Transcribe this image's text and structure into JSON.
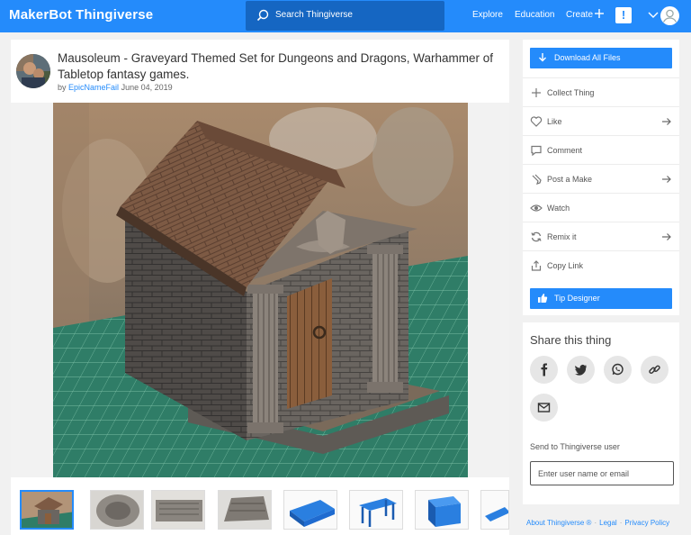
{
  "header": {
    "logo_maker": "MakerBot",
    "logo_thing": "Thingiverse",
    "search_placeholder": "Search Thingiverse",
    "nav_explore": "Explore",
    "nav_education": "Education",
    "nav_create": "Create",
    "alert_glyph": "!"
  },
  "thing": {
    "title": "Mausoleum - Graveyard Themed Set for Dungeons and Dragons, Warhammer of Tabletop fantasy games.",
    "by": "by",
    "author": "EpicNameFail",
    "date": "June 04, 2019"
  },
  "sidebar": {
    "download_label": "Download All Files",
    "actions": [
      {
        "label": "Collect Thing",
        "icon": "plus-icon"
      },
      {
        "label": "Like",
        "icon": "heart-icon"
      },
      {
        "label": "Comment",
        "icon": "comment-icon"
      },
      {
        "label": "Post a Make",
        "icon": "post-make-icon"
      },
      {
        "label": "Watch",
        "icon": "eye-icon"
      },
      {
        "label": "Remix it",
        "icon": "remix-icon"
      },
      {
        "label": "Copy Link",
        "icon": "copy-link-icon"
      }
    ],
    "tip_label": "Tip Designer"
  },
  "share": {
    "title": "Share this thing",
    "networks": [
      "facebook-icon",
      "twitter-icon",
      "whatsapp-icon",
      "link-icon",
      "email-icon"
    ],
    "send_label": "Send to Thingiverse user",
    "send_placeholder": "Enter user name or email"
  },
  "footer": {
    "about": "About Thingiverse ®",
    "legal": "Legal",
    "privacy": "Privacy Policy"
  },
  "colors": {
    "brand_blue": "#248bfb",
    "search_blue": "#1566c2",
    "mat_green": "#2f7d67"
  }
}
